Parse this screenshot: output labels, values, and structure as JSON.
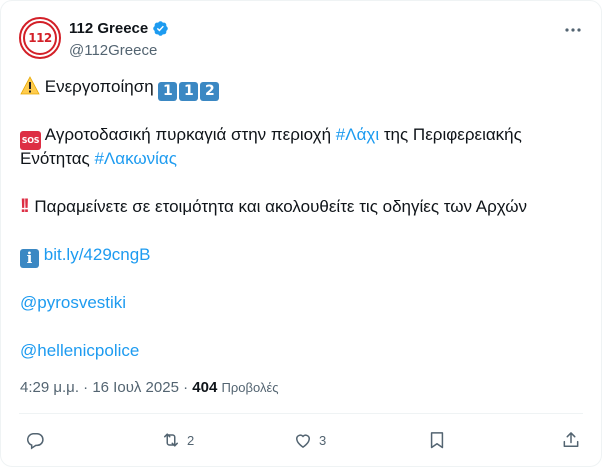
{
  "account": {
    "name": "112 Greece",
    "handle": "@112Greece",
    "avatar_text": "112",
    "verified_color": "#1d9bf0"
  },
  "tweet": {
    "line1": {
      "text": "Ενεργοποίηση",
      "keycaps": [
        "1",
        "1",
        "2"
      ]
    },
    "line2": {
      "sos_label": "SOS",
      "text_before": "Αγροτοδασική πυρκαγιά στην περιοχή ",
      "hashtag1": "#Λάχι",
      "text_after": " της Περιφερειακής"
    },
    "line3": {
      "text_before": "Ενότητας ",
      "hashtag2": "#Λακωνίας"
    },
    "line4": {
      "text": "Παραμείνετε σε ετοιμότητα και ακολουθείτε τις οδηγίες των Αρχών"
    },
    "line5": {
      "info_label": "i",
      "link": "bit.ly/429cngB"
    },
    "mention1": "@pyrosvestiki",
    "mention2": "@hellenicpolice"
  },
  "meta": {
    "time": "4:29 μ.μ.",
    "separator": " · ",
    "date": "16 Ιουλ 2025",
    "views_count": "404",
    "views_label": "Προβολές"
  },
  "actions": {
    "reply_count": "",
    "retweet_count": "2",
    "like_count": "3"
  },
  "colors": {
    "link": "#1d9bf0",
    "text": "#0f1419",
    "secondary": "#536471",
    "brand_red": "#d32028"
  }
}
